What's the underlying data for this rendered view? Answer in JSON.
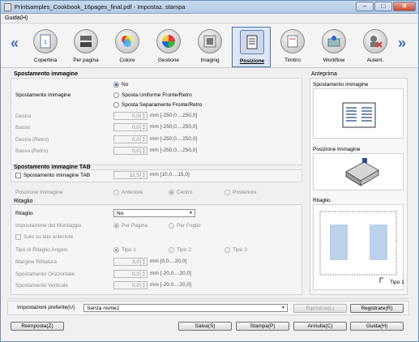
{
  "window": {
    "title": "Printsamples_Cookbook_16pages_final.pdf - Impostaz. stampa"
  },
  "menu": {
    "guida": "Guida(H)"
  },
  "toolbar": {
    "prev": "«",
    "next": "»",
    "items": [
      {
        "label": "Copertina",
        "icon": "cover-icon"
      },
      {
        "label": "Per pagina",
        "icon": "per-page-icon"
      },
      {
        "label": "Colore",
        "icon": "color-icon"
      },
      {
        "label": "Gestione",
        "icon": "management-icon"
      },
      {
        "label": "Imaging",
        "icon": "imaging-icon"
      },
      {
        "label": "Posizione",
        "icon": "position-icon",
        "selected": true
      },
      {
        "label": "Timbro",
        "icon": "stamp-icon"
      },
      {
        "label": "Workflow",
        "icon": "workflow-icon"
      },
      {
        "label": "Autent.",
        "icon": "authentication-icon"
      }
    ]
  },
  "image_shift": {
    "header": "Spostamento immagine",
    "label": "Spostamento immagine",
    "options": [
      "No",
      "Sposta Uniforme Fronte/Retro",
      "Sposta Separamente Fronte/Retro"
    ],
    "fields": [
      {
        "label": "Destra",
        "value": "0,0",
        "unit": "mm [-250,0....250,0]"
      },
      {
        "label": "Basso",
        "value": "0,0",
        "unit": "mm [-250,0....250,0]"
      },
      {
        "label": "Destra (Retro)",
        "value": "0,0",
        "unit": "mm [-250,0....250,0]"
      },
      {
        "label": "Basso (Retro)",
        "value": "0,0",
        "unit": "mm [-250,0....250,0]"
      }
    ]
  },
  "tab_shift": {
    "header": "Spostamento immagine TAB",
    "checkbox": "Spostamento immagine TAB",
    "value": "12,5",
    "unit": "mm [10,0....15,0]",
    "position_label": "Posizione Immagine",
    "positions": [
      "Anteriore",
      "Centro",
      "Posteriore"
    ]
  },
  "trim": {
    "header": "Ritaglio",
    "label": "Ritaglio",
    "value": "No",
    "layout_label": "Impostazione del Montaggio",
    "layout_options": [
      "Per Pagina",
      "Per Foglio"
    ],
    "front_only": "Solo su lato anteriore",
    "angle_label": "Tipo di Ritaglio Angolo",
    "angle_options": [
      "Tipo 1",
      "Tipo 2",
      "Tipo 3"
    ],
    "fields": [
      {
        "label": "Margine Rifilatura",
        "value": "3,0",
        "unit": "mm [0,0....20,0]"
      },
      {
        "label": "Spostamento Orizzontale",
        "value": "0,0",
        "unit": "mm [-20,0....20,0]"
      },
      {
        "label": "Spostamento Verticale",
        "value": "0,0",
        "unit": "mm [-20,0....20,0]"
      }
    ]
  },
  "preview": {
    "header": "Anteprima",
    "image_shift": "Spostamento immagine",
    "image_position": "Posizione Immagine",
    "trim": "Ritaglio",
    "trim_type": "Tipo 1"
  },
  "favorites": {
    "label": "Impostazioni preferite(U)",
    "value": "Senza nome2",
    "restore": "Ripristina(L)",
    "register": "Registrare(R)"
  },
  "footer": {
    "reset": "Reimposta(Z)",
    "save": "Salva(S)",
    "print": "Stampa(P)",
    "cancel": "Annulla(C)",
    "help": "Guida(H)"
  }
}
